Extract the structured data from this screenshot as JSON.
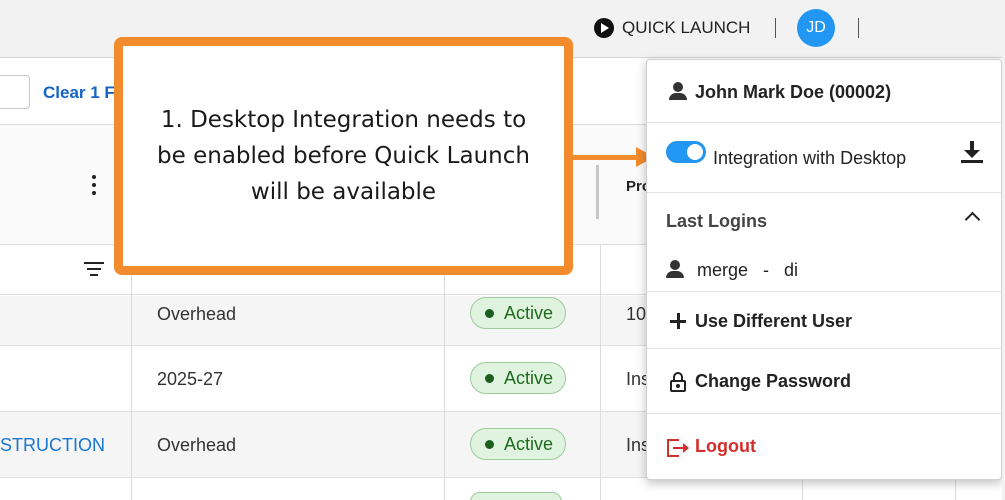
{
  "header": {
    "quick_launch_label": "QUICK LAUNCH",
    "avatar_initials": "JD"
  },
  "filterbar": {
    "clear_filter_label": "Clear 1 F"
  },
  "table": {
    "partial_column_header": "Pro",
    "rows": [
      {
        "name": "",
        "period": "Overhead",
        "status": "Active",
        "extra": "10"
      },
      {
        "name": "",
        "period": "2025-27",
        "status": "Active",
        "extra": "Ins"
      },
      {
        "name": "STRUCTION",
        "period": "Overhead",
        "status": "Active",
        "extra": "Ins"
      }
    ]
  },
  "callout": {
    "text": "1. Desktop Integration needs to be enabled before Quick Launch will be available",
    "accent_color": "#f28a2e"
  },
  "user_menu": {
    "user_name": "John Mark Doe (00002)",
    "integration_label": "Integration with Desktop",
    "integration_enabled": true,
    "last_logins_label": "Last Logins",
    "last_login_entry": "merge   -   di",
    "use_different_user_label": "Use Different User",
    "change_password_label": "Change Password",
    "logout_label": "Logout"
  },
  "colors": {
    "brand_blue": "#2196f3",
    "link_blue": "#1976d2",
    "active_green": "#1e6b1e",
    "logout_red": "#d32f2f"
  }
}
